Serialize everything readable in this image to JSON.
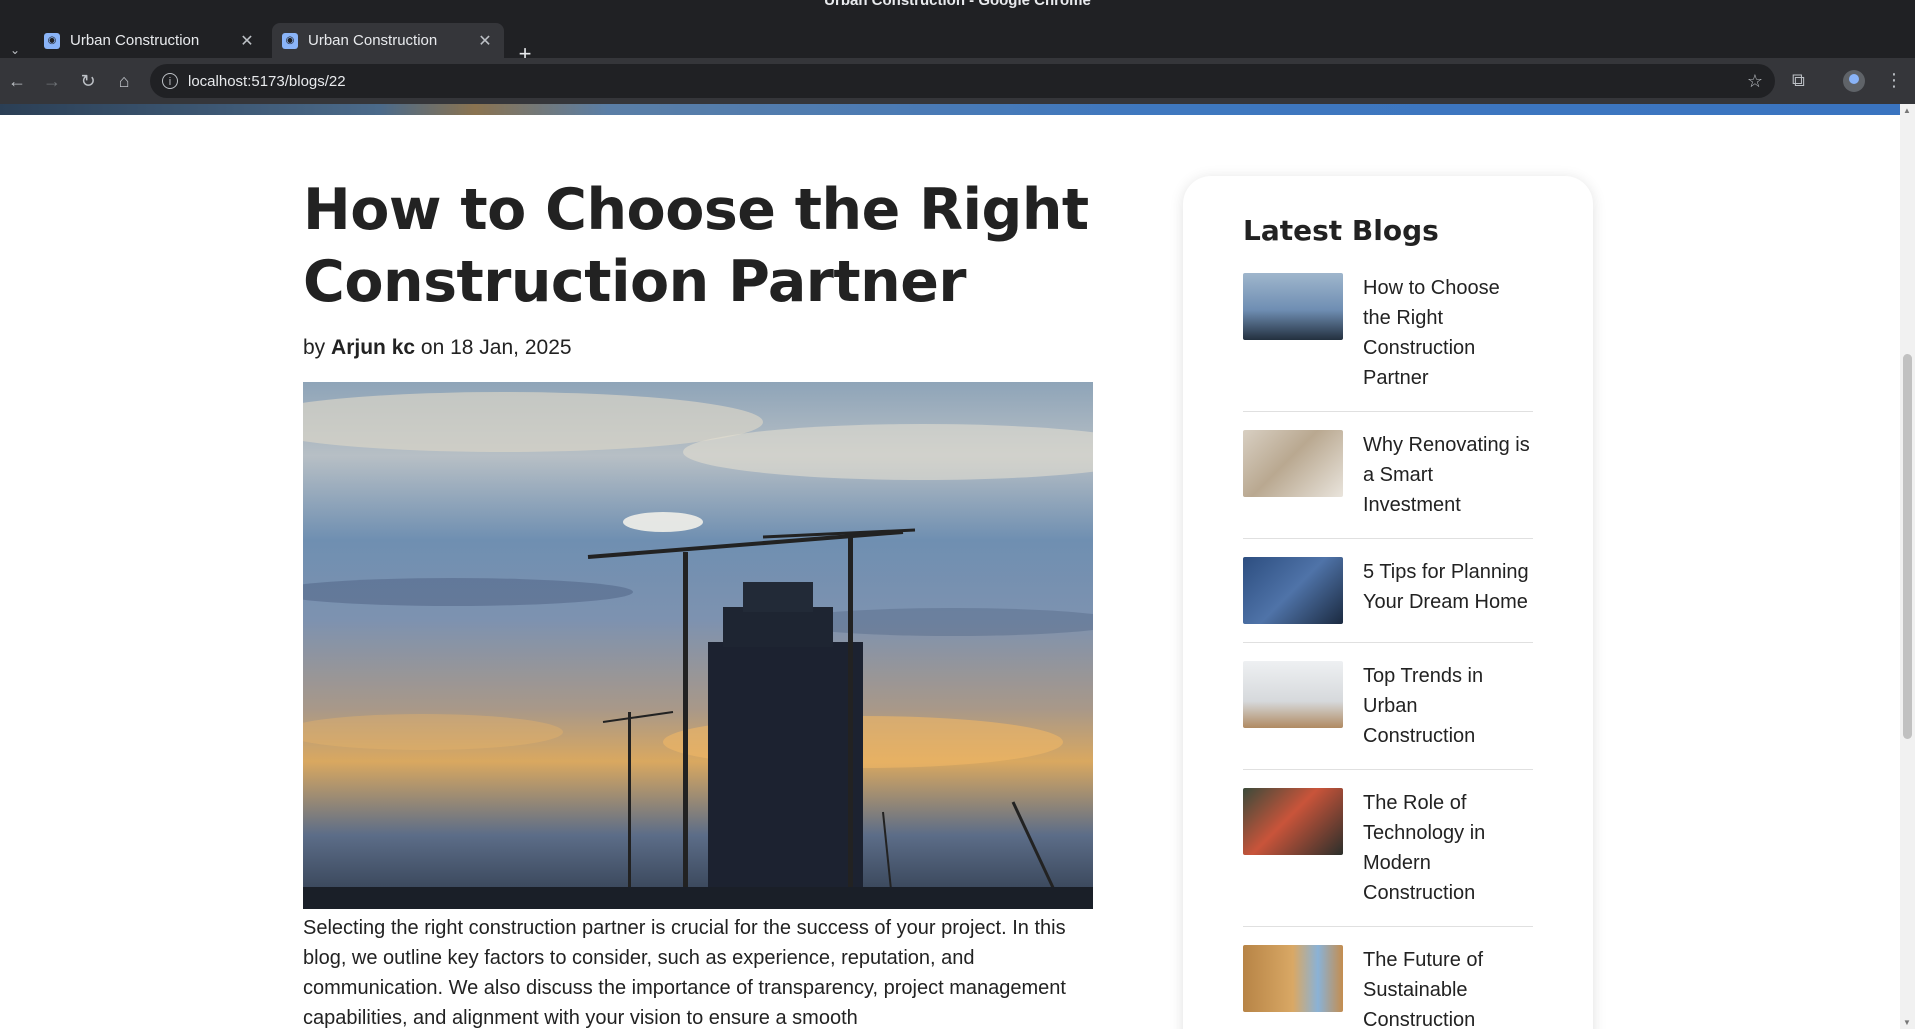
{
  "window": {
    "title": "Urban Construction - Google Chrome"
  },
  "tabs": [
    {
      "label": "Urban Construction",
      "active": false
    },
    {
      "label": "Urban Construction",
      "active": true
    }
  ],
  "toolbar": {
    "url": "localhost:5173/blogs/22"
  },
  "article": {
    "title": "How to Choose the Right Construction Partner",
    "byline_prefix": "by",
    "author": "Arjun kc",
    "date_prefix": "on",
    "date": "18 Jan, 2025",
    "body": "Selecting the right construction partner is crucial for the success of your project. In this blog, we outline key factors to consider, such as experience, reputation, and communication. We also discuss the importance of transparency, project management capabilities, and alignment with your vision to ensure a smooth"
  },
  "sidebar": {
    "heading": "Latest Blogs",
    "items": [
      {
        "title": "How to Choose the Right Construction Partner"
      },
      {
        "title": "Why Renovating is a Smart Investment"
      },
      {
        "title": "5 Tips for Planning Your Dream Home"
      },
      {
        "title": "Top Trends in Urban Construction"
      },
      {
        "title": "The Role of Technology in Modern Construction"
      },
      {
        "title": "The Future of Sustainable Construction"
      }
    ]
  }
}
